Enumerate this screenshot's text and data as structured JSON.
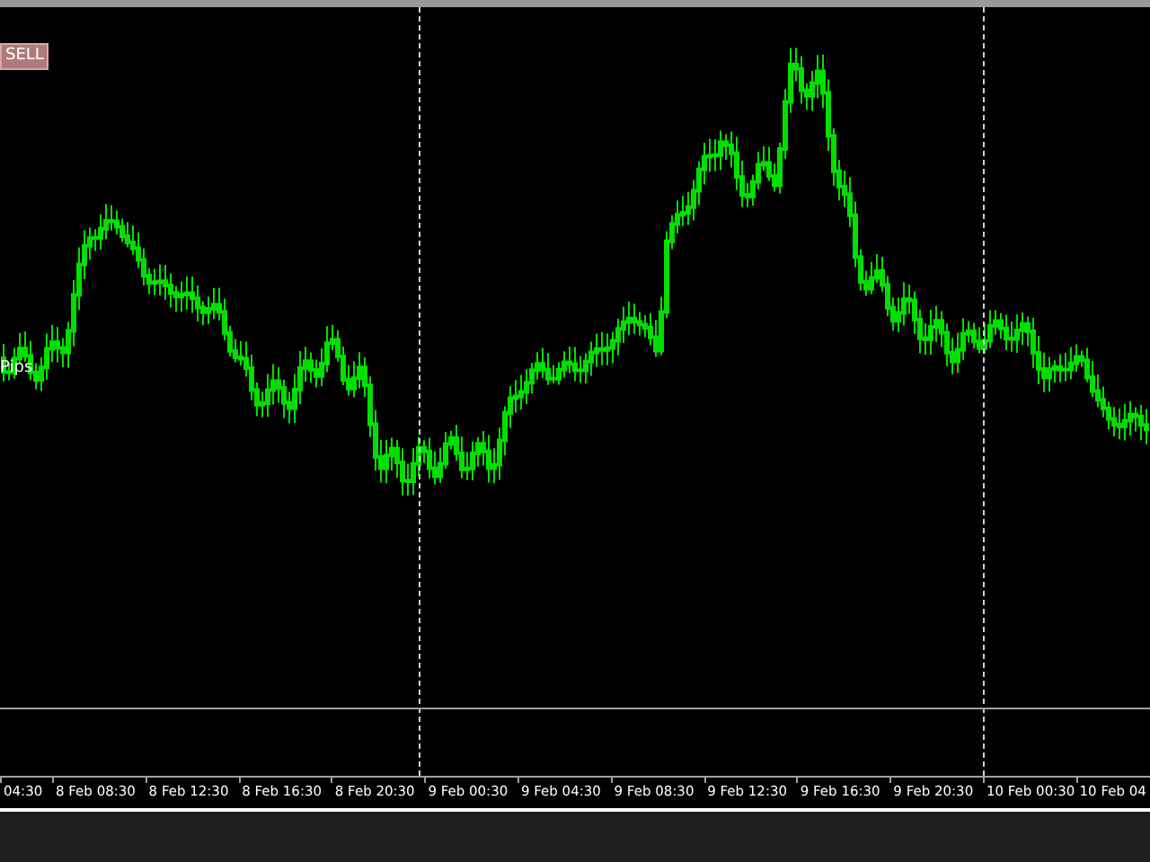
{
  "sell_button": {
    "label": "SELL"
  },
  "pips_label": "Pips",
  "time_axis": {
    "labels": [
      "04:30",
      "8 Feb 08:30",
      "8 Feb 12:30",
      "8 Feb 16:30",
      "8 Feb 20:30",
      "9 Feb 00:30",
      "9 Feb 04:30",
      "9 Feb 08:30",
      "9 Feb 12:30",
      "9 Feb 16:30",
      "9 Feb 20:30",
      "10 Feb 00:30",
      "10 Feb 04"
    ]
  }
}
